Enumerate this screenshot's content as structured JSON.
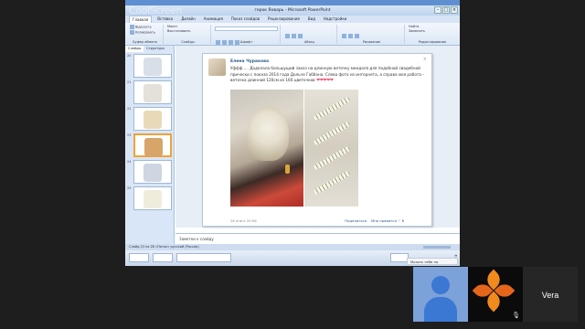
{
  "app": {
    "title": "герок Январь - Microsoft PowerPoint",
    "watermark": "CoolScreen",
    "window_buttons": [
      "–",
      "□",
      "×"
    ]
  },
  "menu": {
    "tabs": [
      "Главная",
      "Вставка",
      "Дизайн",
      "Анимация",
      "Показ слайдов",
      "Рецензирование",
      "Вид",
      "Надстройки"
    ],
    "active_index": 0
  },
  "ribbon": {
    "groups": [
      "Буфер обмена",
      "Слайды",
      "Шрифт",
      "Абзац",
      "Рисование",
      "Редактирование"
    ],
    "clipboard": [
      "Вырезать",
      "Копировать",
      "Формат"
    ],
    "slides": [
      "Макет",
      "Восстановить",
      "Удалить"
    ],
    "editing": [
      "Найти",
      "Заменить",
      "Выделить"
    ]
  },
  "slides_panel": {
    "tabs": [
      "Слайды",
      "Структура"
    ],
    "items": [
      {
        "num": "20",
        "color": "#d9dfe8"
      },
      {
        "num": "21",
        "color": "#e3e1d9"
      },
      {
        "num": "22",
        "color": "#e8d9b8"
      },
      {
        "num": "23",
        "color": "#d7a56a"
      },
      {
        "num": "24",
        "color": "#cfd6e2"
      },
      {
        "num": "25",
        "color": "#f0ecdc"
      }
    ],
    "active_index": 3
  },
  "post": {
    "author": "Елена Чуракова",
    "text": "Уффф..... Доделала большущий заказ на длинную веточку миндаля для подобной свадебной прически с показа 2014 года Дольче Габбана. Слева фото из интернета, а справа моя работа - веточка длинной 120см из 160 цветочков",
    "hearts": "❤❤❤❤❤",
    "date": "26 янв в 20:06",
    "share": "Поделиться",
    "likes": "Мне нравится ♡ 8"
  },
  "notes": {
    "placeholder": "Заметки к слайду"
  },
  "status": {
    "text": "Слайд 23 из 28    «Поток»    русский (Россия)"
  },
  "tooltip": {
    "text": "Можно тебе по быстрее..."
  },
  "participant": {
    "name": "Vera"
  },
  "colors": {
    "accent": "#5f8fd0",
    "link": "#2a5885",
    "logo": "#f08a1d",
    "self_tile": "#7da1d9"
  }
}
